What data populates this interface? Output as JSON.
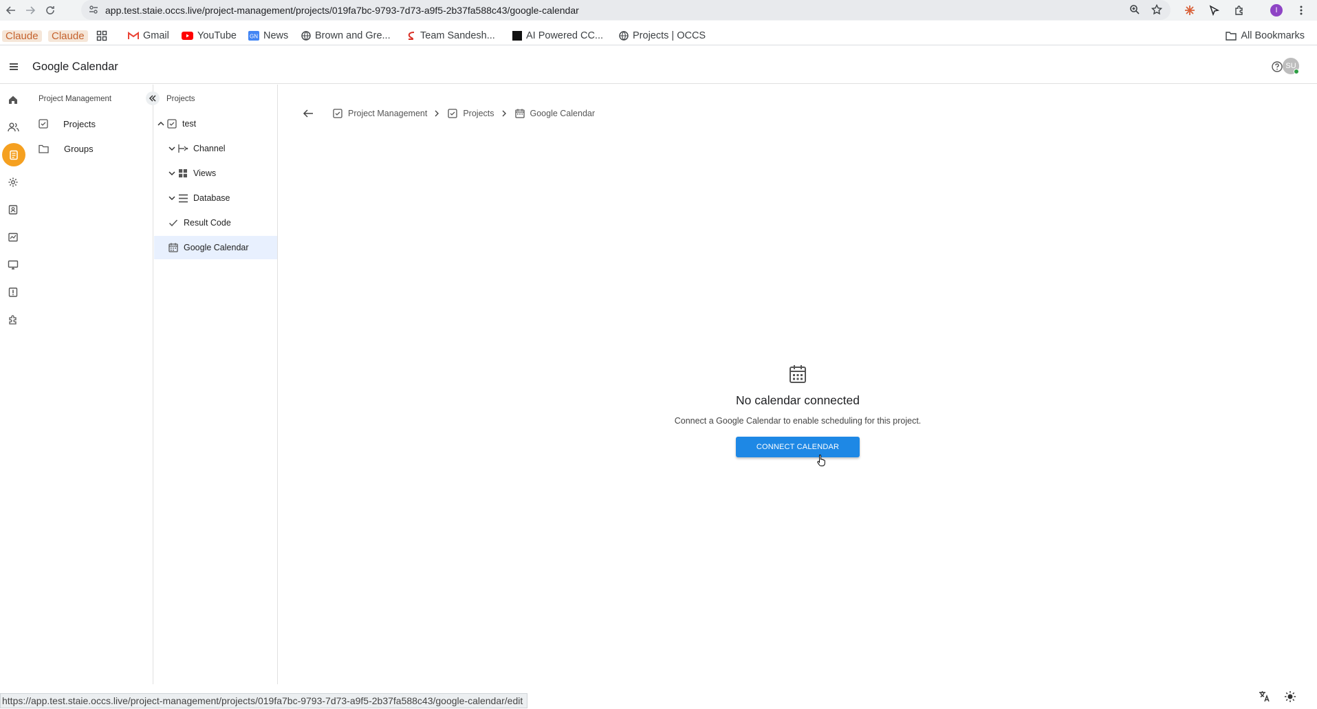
{
  "browser": {
    "url": "app.test.staie.occs.live/project-management/projects/019fa7bc-9793-7d73-a9f5-2b37fa588c43/google-calendar",
    "profile_initial": "I",
    "status_url": "https://app.test.staie.occs.live/project-management/projects/019fa7bc-9793-7d73-a9f5-2b37fa588c43/google-calendar/edit"
  },
  "bookmarks": {
    "items": [
      "Claude",
      "Claude",
      "Gmail",
      "YouTube",
      "News",
      "Brown and Gre...",
      "Team Sandesh...",
      "AI Powered CC...",
      "Projects | OCCS"
    ],
    "all_label": "All Bookmarks"
  },
  "header": {
    "title": "Google Calendar",
    "avatar_initials": "SU"
  },
  "panel1": {
    "heading": "Project Management",
    "items": [
      "Projects",
      "Groups"
    ]
  },
  "panel2": {
    "heading": "Projects",
    "tree": [
      "test",
      "Channel",
      "Views",
      "Database",
      "Result Code",
      "Google Calendar"
    ]
  },
  "breadcrumb": [
    "Project Management",
    "Projects",
    "Google Calendar"
  ],
  "empty_state": {
    "title": "No calendar connected",
    "description": "Connect a Google Calendar to enable scheduling for this project.",
    "button_label": "CONNECT CALENDAR"
  },
  "colors": {
    "accent_orange": "#f5a020",
    "primary_blue": "#1e88e5",
    "selected_bg": "#e8f0fe"
  }
}
